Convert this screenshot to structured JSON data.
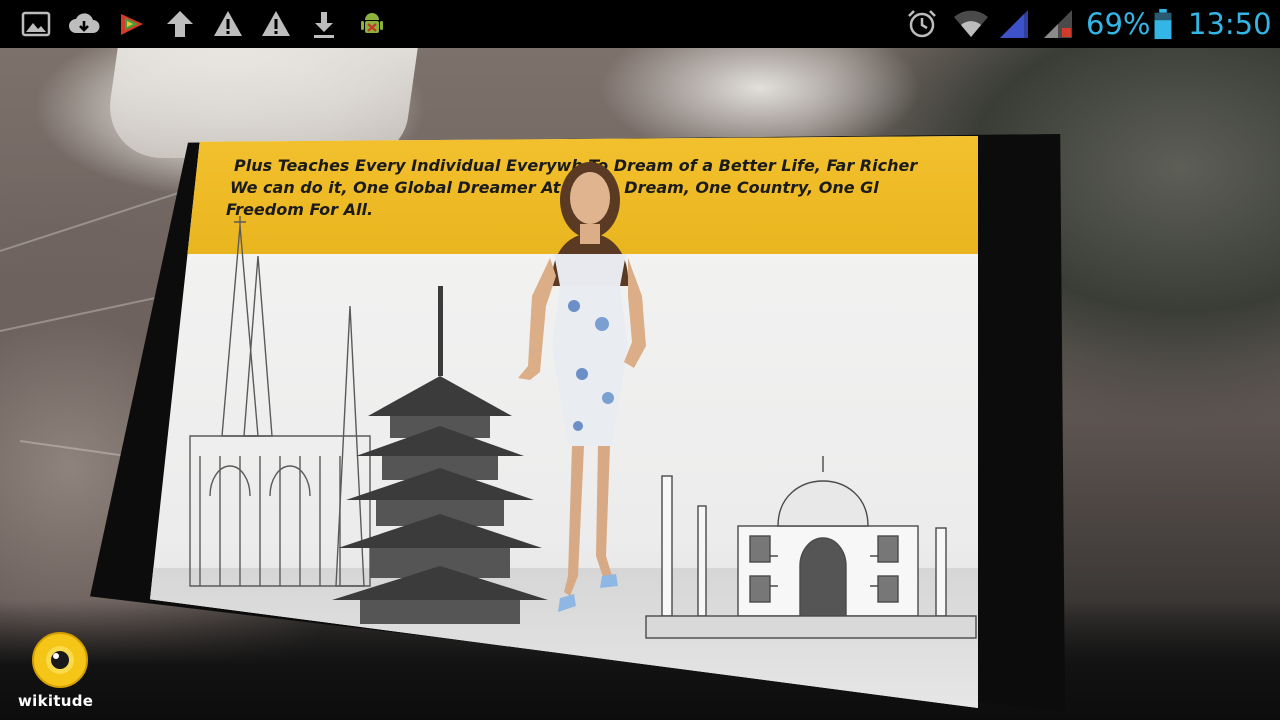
{
  "status_bar": {
    "battery_text": "69%",
    "time": "13:50",
    "accent_color": "#33b5e5",
    "icons": [
      "gallery-icon",
      "cloud-download-icon",
      "app-icon",
      "upload-arrow-icon",
      "warning-icon",
      "warning-icon",
      "download-icon",
      "android-debug-icon",
      "alarm-icon",
      "wifi-icon",
      "signal-icon",
      "signal-no-sim-icon",
      "battery-icon"
    ]
  },
  "ar_panel": {
    "banner_lines": [
      "Plus Teaches Every Individual Everywh     To Dream of a Better Life, Far Richer",
      "We can do it, One Global Dreamer At      e.One Dream, One Country, One Gl",
      "Freedom For All."
    ],
    "banner_color": "#f0bc2a"
  },
  "brand": {
    "name": "wikitude",
    "color": "#f5c518"
  }
}
